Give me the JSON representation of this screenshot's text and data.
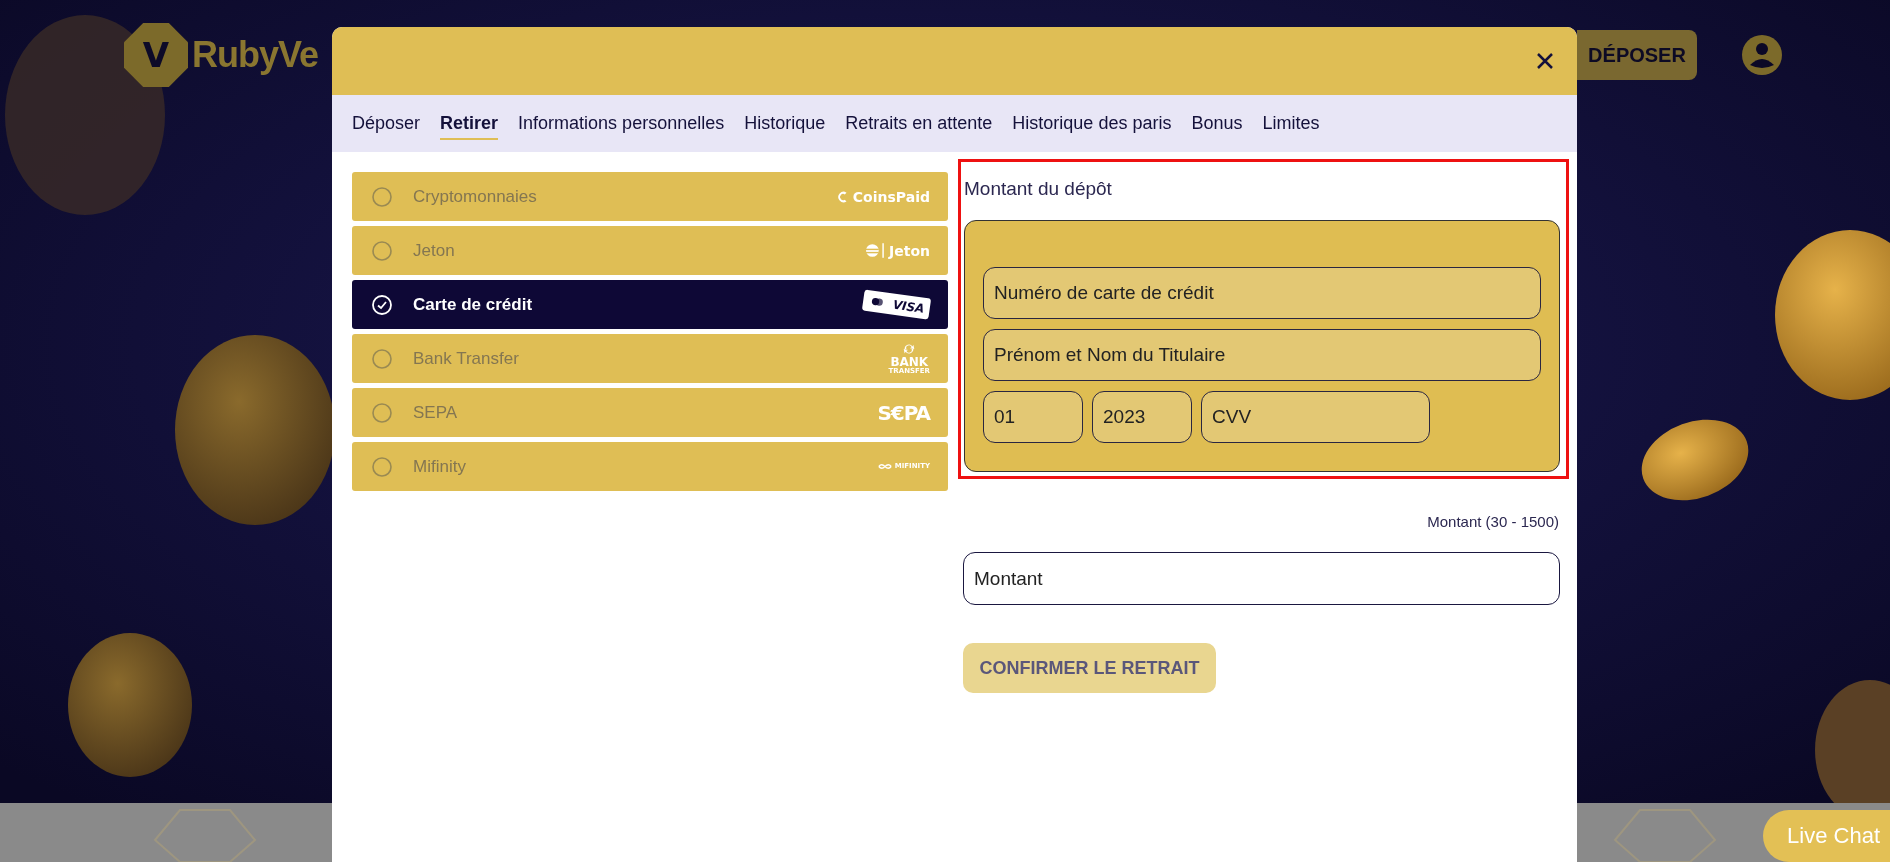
{
  "header": {
    "logo_mark": "V",
    "logo": "RubyVe",
    "deposit_button": "DÉPOSER"
  },
  "modal": {
    "tabs": [
      {
        "label": "Déposer",
        "selected": false
      },
      {
        "label": "Retirer",
        "selected": true
      },
      {
        "label": "Informations personnelles",
        "selected": false
      },
      {
        "label": "Historique",
        "selected": false
      },
      {
        "label": "Retraits en attente",
        "selected": false
      },
      {
        "label": "Historique des paris",
        "selected": false
      },
      {
        "label": "Bonus",
        "selected": false
      },
      {
        "label": "Limites",
        "selected": false
      }
    ],
    "methods": [
      {
        "name": "Cryptomonnaies",
        "selected": false,
        "kind": "coinspaid",
        "logo": [
          "CoinsPaid"
        ]
      },
      {
        "name": "Jeton",
        "selected": false,
        "kind": "jeton",
        "logo": [
          "Jeton"
        ]
      },
      {
        "name": "Carte de crédit",
        "selected": true,
        "kind": "cards",
        "logo": [
          "VISA"
        ]
      },
      {
        "name": "Bank Transfer",
        "selected": false,
        "kind": "bank",
        "logo": [
          "BANK",
          "TRANSFER"
        ]
      },
      {
        "name": "SEPA",
        "selected": false,
        "kind": "sepa",
        "logo": [
          "S€PA"
        ]
      },
      {
        "name": "Mifinity",
        "selected": false,
        "kind": "mifinity",
        "logo": [
          "MIFINITY"
        ]
      }
    ],
    "form": {
      "title": "Montant du dépôt",
      "card_fields": [
        {
          "kind": "wide",
          "placeholder": "Numéro de carte de crédit"
        },
        {
          "kind": "wide",
          "placeholder": "Prénom et Nom du Titulaire"
        },
        {
          "kind": "small",
          "value": "01"
        },
        {
          "kind": "small",
          "value": "2023"
        },
        {
          "kind": "medium",
          "placeholder": "CVV"
        }
      ],
      "range_label": "Montant (30 - 1500)",
      "amount": {
        "placeholder": "Montant"
      },
      "button": {
        "label": "CONFIRMER LE RETRAIT",
        "disabled": true
      }
    }
  },
  "live_chat": "Live Chat"
}
